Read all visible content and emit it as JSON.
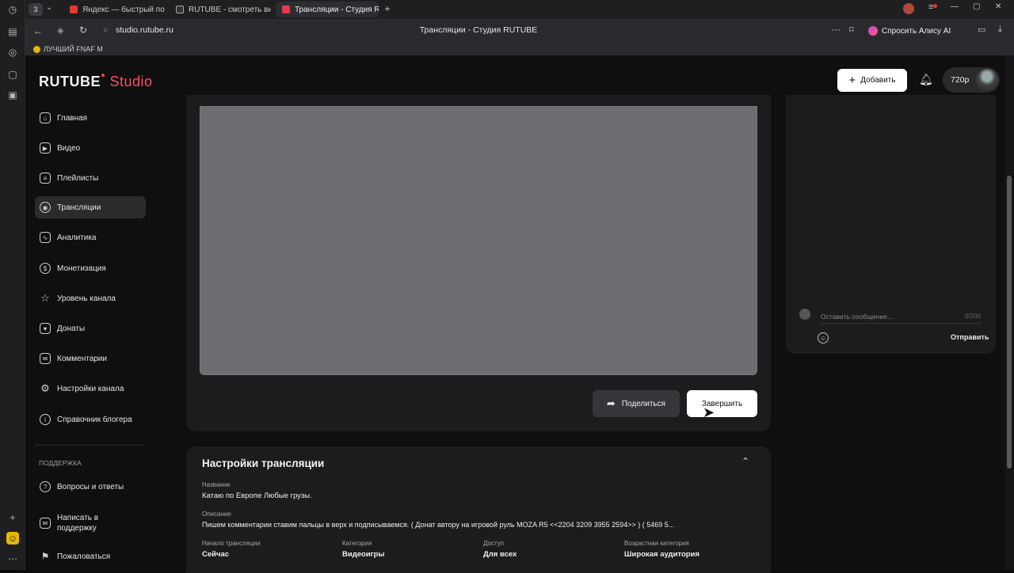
{
  "browser": {
    "tabs": [
      {
        "label": "Яндекс — быстрый поис",
        "color": "#e53935"
      },
      {
        "label": "RUTUBE - смотреть виде",
        "color": "#1e1e1e"
      },
      {
        "label": "Трансляции - Студия R",
        "color": "#e53950"
      }
    ],
    "url": "studio.rutube.ru",
    "page_title": "Трансляции - Студия RUTUBE",
    "alice_label": "Спросить Алису AI",
    "bookmark": "ЛУЧШИЙ FNAF М",
    "tab_badge": "3"
  },
  "header": {
    "logo_main": "RUTUBE",
    "logo_studio": "Studio",
    "add_label": "Добавить",
    "quality": "720p"
  },
  "sidebar": {
    "items": [
      {
        "label": "Главная",
        "icon": "home-icon",
        "glyph": "⌂"
      },
      {
        "label": "Видео",
        "icon": "video-icon",
        "glyph": "▶"
      },
      {
        "label": "Плейлисты",
        "icon": "playlist-icon",
        "glyph": "≡"
      },
      {
        "label": "Трансляции",
        "icon": "broadcast-icon",
        "glyph": "◉"
      },
      {
        "label": "Аналитика",
        "icon": "analytics-icon",
        "glyph": "∿"
      },
      {
        "label": "Монетизация",
        "icon": "money-icon",
        "glyph": "$"
      },
      {
        "label": "Уровень канала",
        "icon": "star-icon",
        "glyph": "☆"
      },
      {
        "label": "Донаты",
        "icon": "donate-icon",
        "glyph": "♥"
      },
      {
        "label": "Комментарии",
        "icon": "comment-icon",
        "glyph": "✉"
      },
      {
        "label": "Настройки канала",
        "icon": "gear-icon",
        "glyph": "⚙"
      },
      {
        "label": "Справочник блогера",
        "icon": "info-icon",
        "glyph": "i"
      }
    ],
    "support_title": "ПОДДЕРЖКА",
    "support": [
      {
        "label": "Вопросы и ответы",
        "icon": "question-icon",
        "glyph": "?"
      },
      {
        "label": "Написать в поддержку",
        "icon": "mail-icon",
        "glyph": "✉"
      },
      {
        "label": "Пожаловаться",
        "icon": "flag-icon",
        "glyph": "⚑"
      }
    ]
  },
  "player": {
    "share_label": "Поделиться",
    "end_label": "Завершить"
  },
  "chat": {
    "placeholder": "Оставить сообщение...",
    "counter": "0/200",
    "send_label": "Отправить"
  },
  "settings": {
    "title": "Настройки трансляции",
    "name_label": "Название",
    "name_value": "Катаю по Европе Любые грузы.",
    "desc_label": "Описание",
    "desc_value": "Пишем комментарии ставим пальцы в верх и подписываемся. ( Донат автору на игровой руль MOZA R5 <<2204 3209 3955 2594>> ) ( 5469 5...",
    "start_label": "Начало трансляции",
    "start_value": "Сейчас",
    "category_label": "Категория",
    "category_value": "Видеоигры",
    "access_label": "Доступ",
    "access_value": "Для всех",
    "age_label": "Возрастная категория",
    "age_value": "Широкая аудитория"
  }
}
